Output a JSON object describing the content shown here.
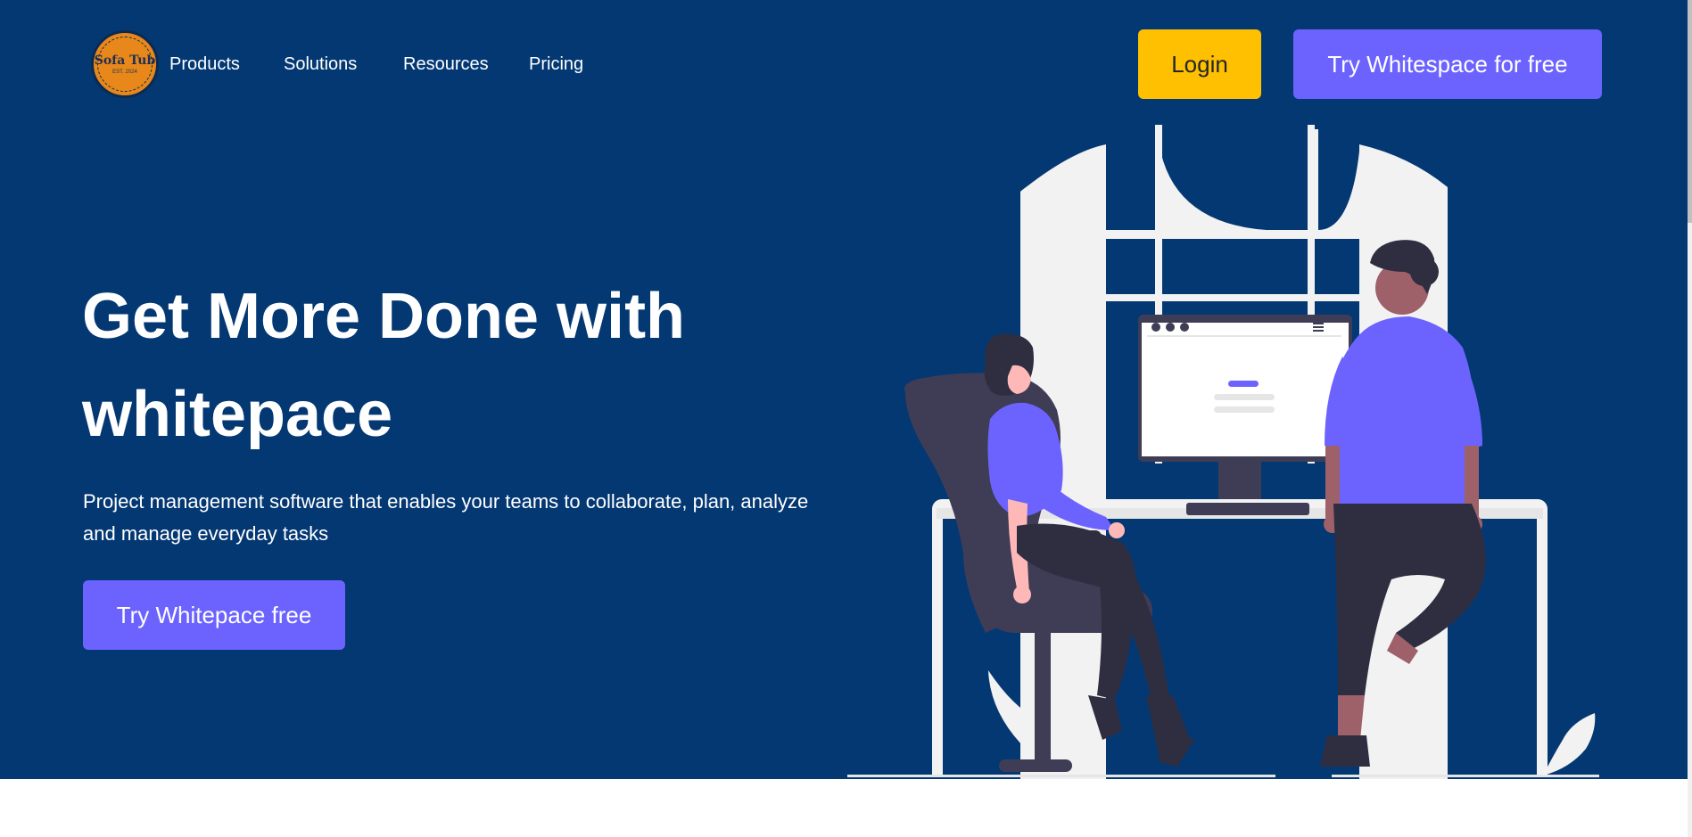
{
  "logo": {
    "name": "Sofa Tub",
    "est": "EST. 2024"
  },
  "nav": {
    "items": [
      {
        "label": "Products"
      },
      {
        "label": "Solutions"
      },
      {
        "label": "Resources"
      },
      {
        "label": "Pricing"
      }
    ],
    "login_label": "Login",
    "try_label": "Try Whitespace for free"
  },
  "hero": {
    "headline_line1": "Get More Done with",
    "headline_line2": "whitepace",
    "subtext": "Project management software that enables your teams to collaborate, plan, analyze and manage everyday tasks",
    "cta_label": "Try Whitepace free"
  },
  "colors": {
    "hero_bg": "#043873",
    "accent_purple": "#6c63ff",
    "accent_yellow": "#ffc001",
    "text_white": "#ffffff"
  }
}
